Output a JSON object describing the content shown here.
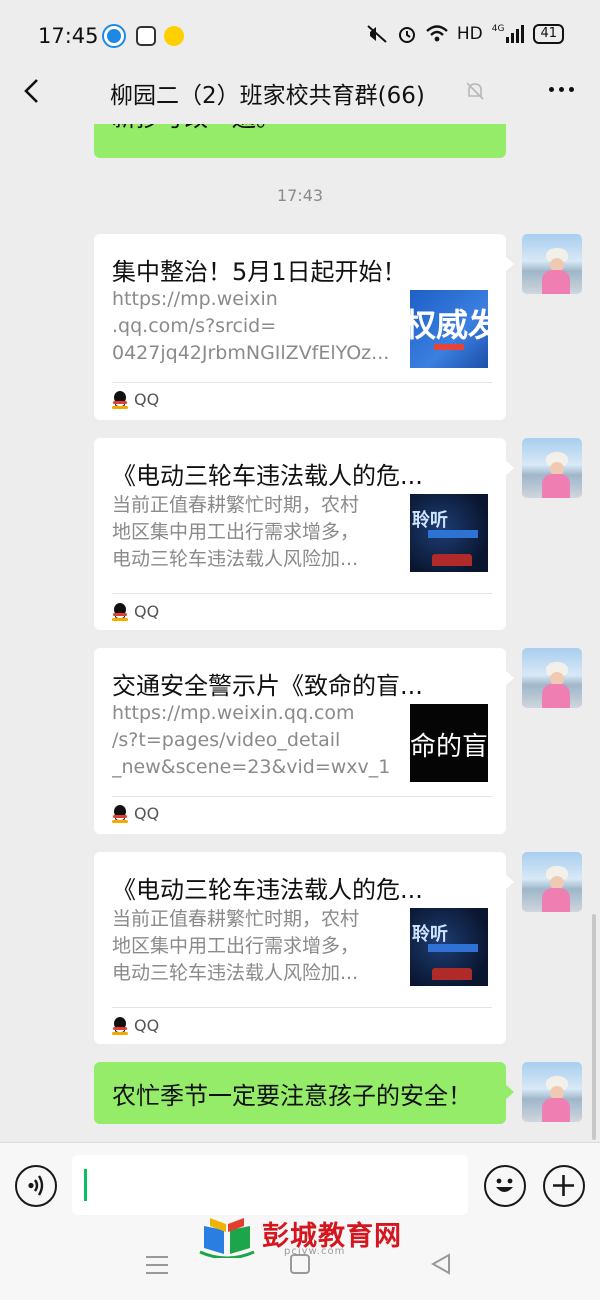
{
  "status_bar": {
    "time": "17:45",
    "network": "HD",
    "signal_label": "4G",
    "battery": "41",
    "icons": [
      "app-notification-icon",
      "baidu-icon",
      "app-icon",
      "mute-notification-icon",
      "alarm-icon",
      "wifi-icon",
      "signal-icon",
      "battery-icon"
    ]
  },
  "header": {
    "title": "柳园二（2）班家校共育群(66)",
    "icons": [
      "back-arrow-icon",
      "muted-bell-icon",
      "more-icon"
    ]
  },
  "chat": {
    "top_bubble_partial": "新抄写改一遍。",
    "timestamp": "17:43",
    "messages": [
      {
        "title": "集中整治！5月1日起开始！",
        "desc": [
          "https://mp.weixin",
          ".qq.com/s?srcid=",
          "0427jq42JrbmNGIlZVfElYOz..."
        ],
        "thumb_text": "权威发布",
        "source": "QQ"
      },
      {
        "title": "《电动三轮车违法载人的危...",
        "desc": [
          "当前正值春耕繁忙时期，农村",
          "地区集中用工出行需求增多，",
          "电动三轮车违法载人风险加..."
        ],
        "thumb_text": "聆听",
        "source": "QQ"
      },
      {
        "title": "交通安全警示片《致命的盲...",
        "desc": [
          "https://mp.weixin.qq.com",
          "/s?t=pages/video_detail",
          "_new&scene=23&vid=wxv_1..."
        ],
        "thumb_text": "命的盲",
        "source": "QQ"
      },
      {
        "title": "《电动三轮车违法载人的危...",
        "desc": [
          "当前正值春耕繁忙时期，农村",
          "地区集中用工出行需求增多，",
          "电动三轮车违法载人风险加..."
        ],
        "thumb_text": "聆听",
        "source": "QQ"
      }
    ],
    "last_text": "农忙季节一定要注意孩子的安全！"
  },
  "input": {
    "value": "",
    "icons": [
      "voice-icon",
      "emoji-icon",
      "plus-icon"
    ]
  },
  "nav": {
    "icons": [
      "menu-icon",
      "home-icon",
      "back-icon"
    ]
  },
  "watermark": {
    "text": "彭城教育网",
    "sub": "pcjyw.com"
  },
  "colors": {
    "background": "#ededed",
    "bubble_green": "#95ec69",
    "caret_green": "#07c160",
    "watermark_red": "#d6161f"
  }
}
